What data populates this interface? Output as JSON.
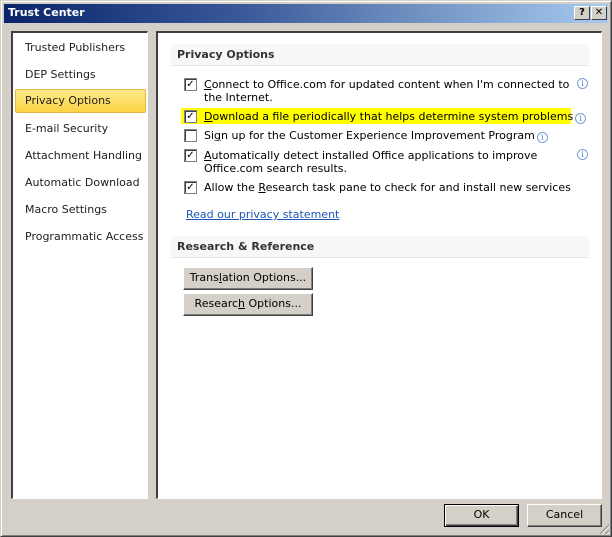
{
  "window": {
    "title": "Trust Center",
    "help_label": "?",
    "close_label": "✕"
  },
  "nav": {
    "items": [
      {
        "label": "Trusted Publishers",
        "selected": false
      },
      {
        "label": "DEP Settings",
        "selected": false
      },
      {
        "label": "Privacy Options",
        "selected": true
      },
      {
        "label": "E-mail Security",
        "selected": false
      },
      {
        "label": "Attachment Handling",
        "selected": false
      },
      {
        "label": "Automatic Download",
        "selected": false
      },
      {
        "label": "Macro Settings",
        "selected": false
      },
      {
        "label": "Programmatic Access",
        "selected": false
      }
    ]
  },
  "privacy": {
    "header": "Privacy Options",
    "options": [
      {
        "pre": "",
        "accel": "C",
        "post": "onnect to Office.com for updated content when I'm connected to the Internet.",
        "checked": true,
        "info": true,
        "highlighted": false
      },
      {
        "pre": "",
        "accel": "D",
        "post": "ownload a file periodically that helps determine system problems",
        "checked": true,
        "info": true,
        "highlighted": true
      },
      {
        "pre": "Si",
        "accel": "g",
        "post": "n up for the Customer Experience Improvement Program",
        "checked": false,
        "info": true,
        "highlighted": false
      },
      {
        "pre": "",
        "accel": "A",
        "post": "utomatically detect installed Office applications to improve Office.com search results.",
        "checked": true,
        "info": true,
        "highlighted": false
      },
      {
        "pre": "Allow the ",
        "accel": "R",
        "post": "esearch task pane to check for and install new services",
        "checked": true,
        "info": false,
        "highlighted": false
      }
    ],
    "link": "Read our privacy statement"
  },
  "research": {
    "header": "Research & Reference",
    "translation_button": {
      "pre": "Trans",
      "accel": "l",
      "post": "ation Options..."
    },
    "research_button": {
      "pre": "Researc",
      "accel": "h",
      "post": " Options..."
    }
  },
  "footer": {
    "ok_label": "OK",
    "cancel_label": "Cancel"
  },
  "colors": {
    "selection": "#fbd445",
    "highlight": "#ffff00",
    "link": "#1a55b5",
    "titlebar_start": "#0a246a",
    "titlebar_end": "#a6caf0"
  }
}
